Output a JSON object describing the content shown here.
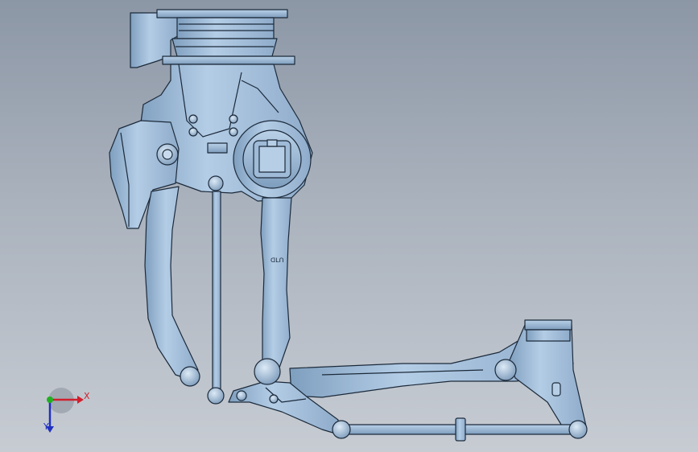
{
  "viewport": {
    "background_top": "#8c97a6",
    "background_bottom": "#c7ccd3"
  },
  "model": {
    "fill_color": "#a9c6e2",
    "shade_color": "#7f9fbf",
    "edge_color": "#1c2a3a",
    "engraving_text": "ᗡᒪᑎ"
  },
  "triad": {
    "x_label": "X",
    "y_label": "Y",
    "x_color": "#d0202e",
    "y_color": "#2030c0",
    "origin_color": "#20b020"
  }
}
